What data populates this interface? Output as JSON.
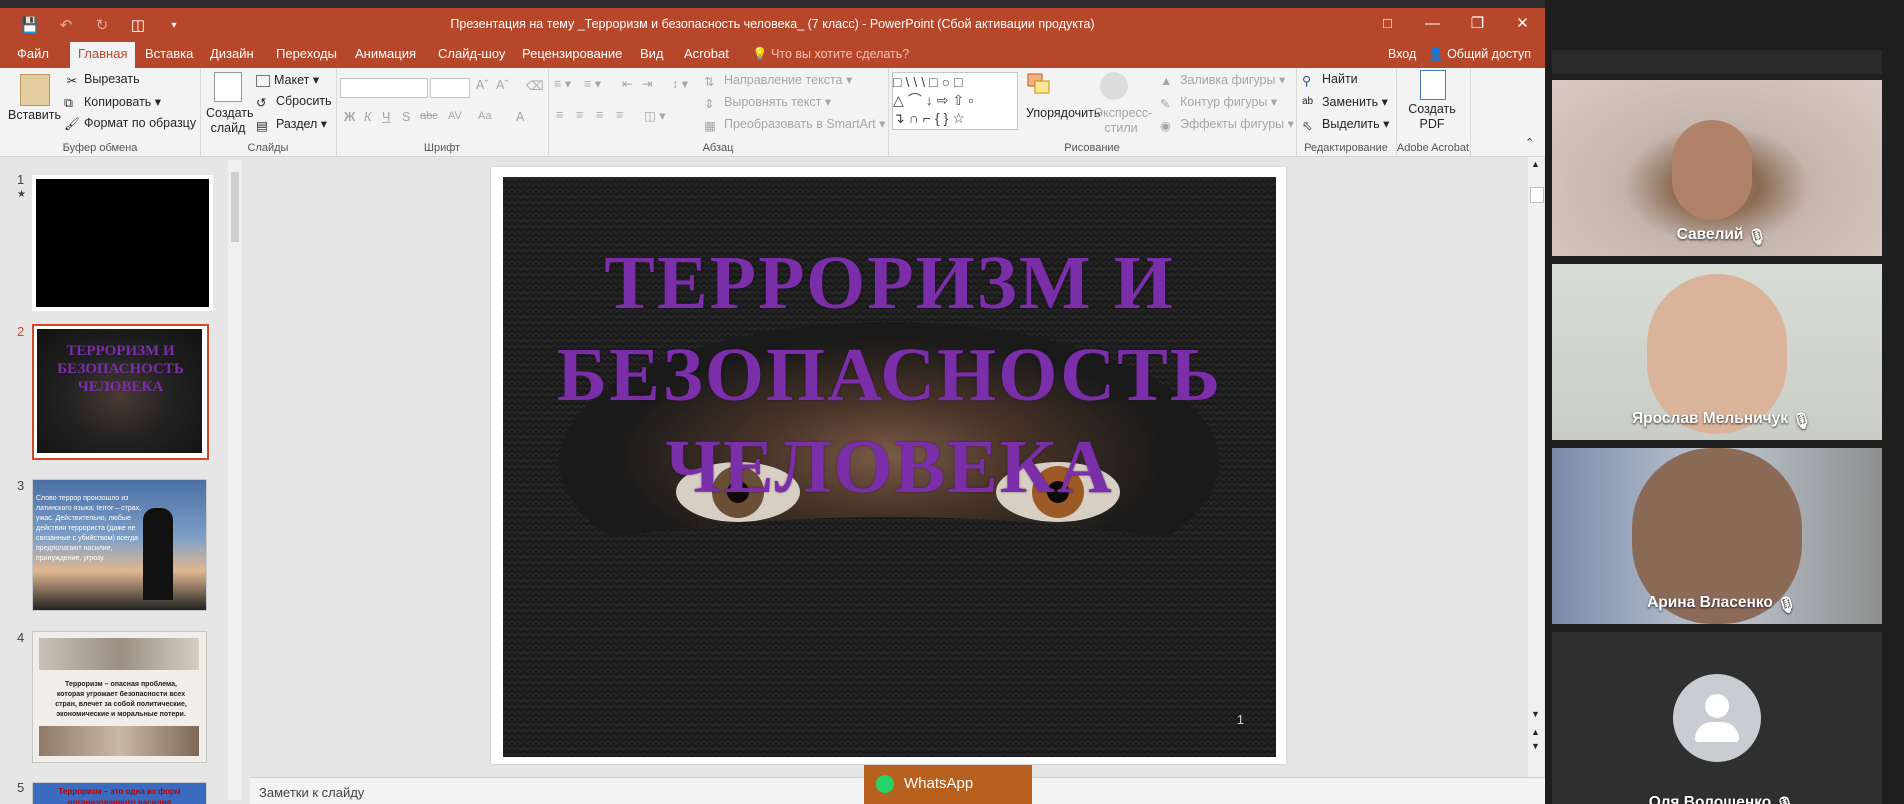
{
  "window": {
    "title": "Презентация на тему _Терроризм и безопасность человека_ (7 класс) - PowerPoint (Сбой активации продукта)"
  },
  "tabs": [
    "Файл",
    "Главная",
    "Вставка",
    "Дизайн",
    "Переходы",
    "Анимация",
    "Слайд-шоу",
    "Рецензирование",
    "Вид",
    "Acrobat"
  ],
  "active_tab": "Главная",
  "tell_me": "Что вы хотите сделать?",
  "signin": "Вход",
  "share": "Общий доступ",
  "ribbon": {
    "clipboard": {
      "paste": "Вставить",
      "cut": "Вырезать",
      "copy": "Копировать",
      "format_painter": "Формат по образцу",
      "label": "Буфер обмена"
    },
    "slides": {
      "new_slide": "Создать слайд",
      "layout": "Макет",
      "reset": "Сбросить",
      "section": "Раздел",
      "label": "Слайды"
    },
    "font": {
      "label": "Шрифт",
      "bold": "Ж",
      "italic": "К",
      "underline": "Ч",
      "shadow": "S",
      "strike": "abc",
      "spacing": "AV",
      "case": "Aa"
    },
    "paragraph": {
      "text_direction": "Направление текста",
      "align_text": "Выровнять текст",
      "smartart": "Преобразовать в SmartArt",
      "label": "Абзац"
    },
    "drawing": {
      "arrange": "Упорядочить",
      "quick_styles": "Экспресс-стили",
      "fill": "Заливка фигуры",
      "outline": "Контур фигуры",
      "effects": "Эффекты фигуры",
      "label": "Рисование"
    },
    "editing": {
      "find": "Найти",
      "replace": "Заменить",
      "select": "Выделить",
      "label": "Редактирование"
    },
    "acrobat": {
      "create_pdf": "Создать PDF",
      "label": "Adobe Acrobat"
    }
  },
  "thumbnails": [
    {
      "num": "1",
      "star": "★"
    },
    {
      "num": "2",
      "text": "ТЕРРОРИЗМ И БЕЗОПАСНОСТЬ ЧЕЛОВЕКА"
    },
    {
      "num": "3",
      "text": "Слово террор произошло из латинского языка: terror – страх, ужас. Действительно, любые действия террориста (даже не связанные с убийством) всегда предполагают насилие, принуждение, угрозу."
    },
    {
      "num": "4",
      "text": "Терроризм – опасная проблема, которая угрожает безопасности всех стран, влечет за собой политические, экономические и моральные потери."
    },
    {
      "num": "5",
      "text": "Терроризм – это одна из форм организованного насилия"
    }
  ],
  "slide": {
    "title_lines": [
      "ТЕРРОРИЗМ И",
      "БЕЗОПАСНОСТЬ",
      "ЧЕЛОВЕКА"
    ],
    "number": "1"
  },
  "notes_placeholder": "Заметки к слайду",
  "whatsapp": "WhatsApp",
  "participants": [
    {
      "name": "Савелий"
    },
    {
      "name": "Ярослав Мельничук"
    },
    {
      "name": "Арина Власенко"
    },
    {
      "name": "Оля Волощенко"
    }
  ]
}
